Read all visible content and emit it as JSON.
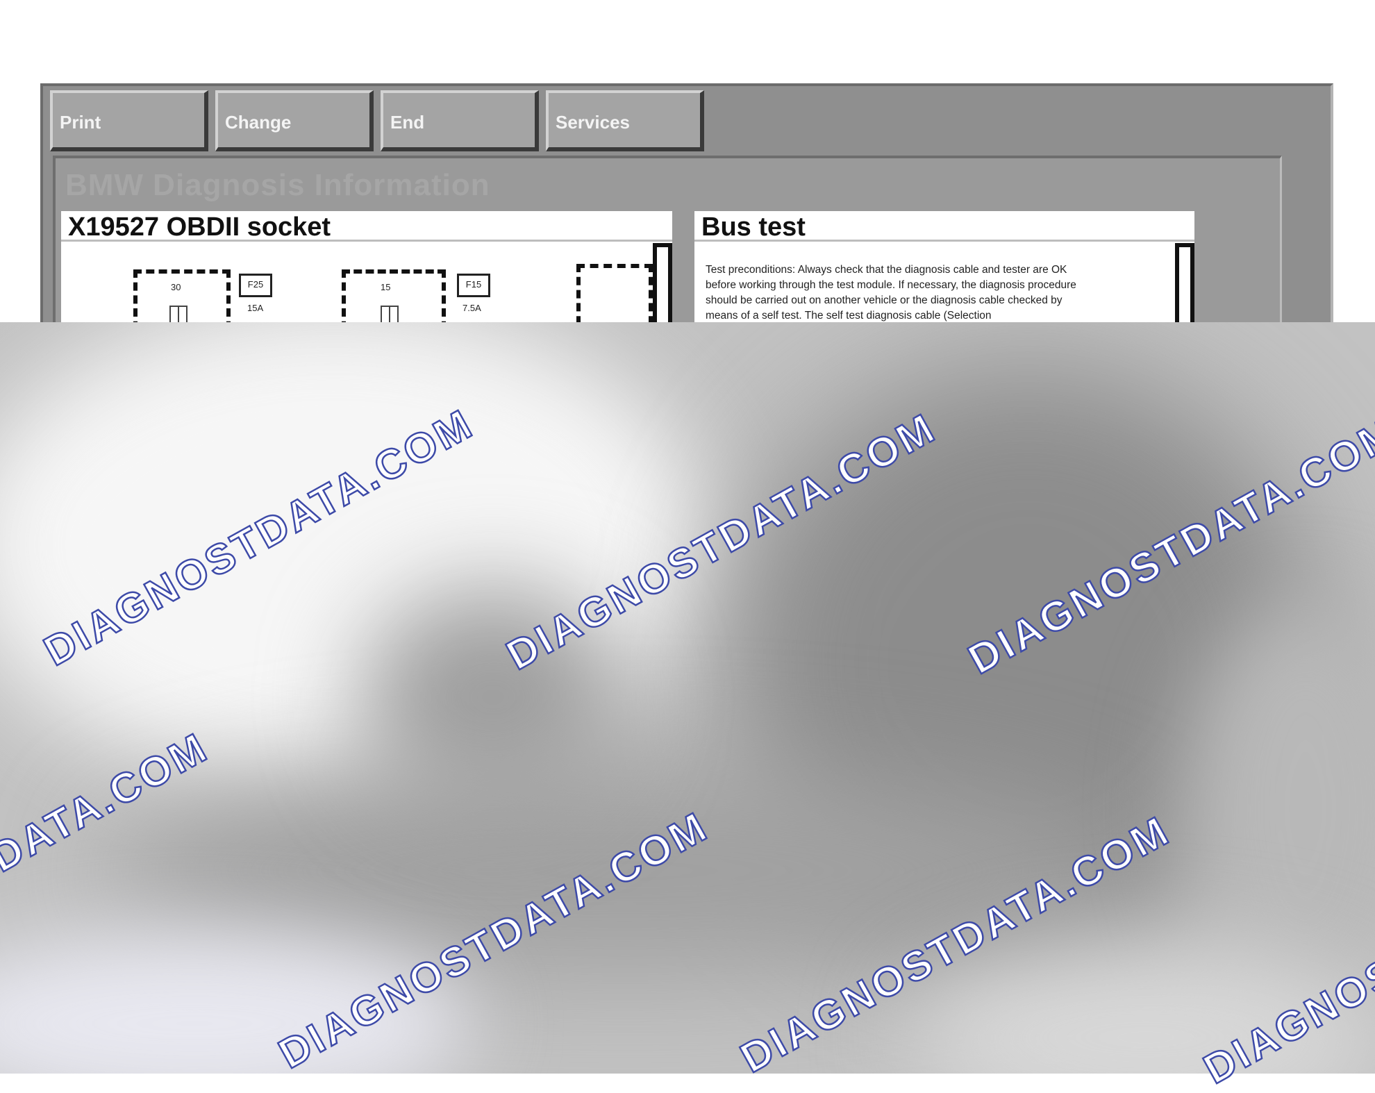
{
  "toolbar": {
    "buttons": [
      {
        "label": "Print"
      },
      {
        "label": "Change"
      },
      {
        "label": "End"
      },
      {
        "label": "Services"
      }
    ]
  },
  "frame": {
    "title": "BMW Diagnosis Information"
  },
  "left_panel": {
    "title": "X19527 OBDII socket",
    "fuses": [
      {
        "terminal": "30",
        "fuse": "F25",
        "rating": "15A"
      },
      {
        "terminal": "15",
        "fuse": "F15",
        "rating": "7.5A"
      }
    ]
  },
  "right_panel": {
    "title": "Bus test",
    "lines": [
      "Test preconditions: Always check that the diagnosis cable and tester are OK",
      "before working through the test module.  If necessary, the diagnosis procedure",
      "should be carried out on another vehicle or the diagnosis cable checked by",
      "means of a self test. The self test diagnosis cable (Selection"
    ]
  },
  "watermark": {
    "text": "DIAGNOSTDATA.COM"
  },
  "colors": {
    "window_bg": "#8f8f8f",
    "watermark_outline": "#3d4aa8"
  }
}
